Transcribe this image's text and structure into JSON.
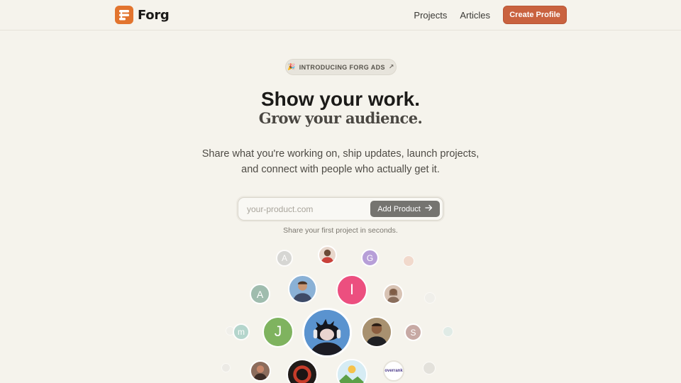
{
  "header": {
    "brand": "Forg",
    "nav": [
      "Projects",
      "Articles"
    ],
    "cta": "Create Profile"
  },
  "announcement": {
    "emoji": "🎉",
    "text": "INTRODUCING FORG ADS",
    "arrow": "↗"
  },
  "hero": {
    "line1": "Show your work.",
    "line2": "Grow your audience.",
    "subtitle_line1": "Share what you're working on, ship updates, launch projects,",
    "subtitle_line2": "and connect with people who actually get it."
  },
  "signup": {
    "placeholder": "your-product.com",
    "button": "Add Product",
    "hint": "Share your first project in seconds."
  },
  "avatars": {
    "letters": [
      "A",
      "G",
      "A",
      "I",
      "m",
      "J",
      "S"
    ],
    "logo_text": "overrank"
  },
  "colors": {
    "background": "#f5f3ec",
    "brand": "#e2742e",
    "cta": "#c9623f",
    "add_button": "#757470"
  }
}
